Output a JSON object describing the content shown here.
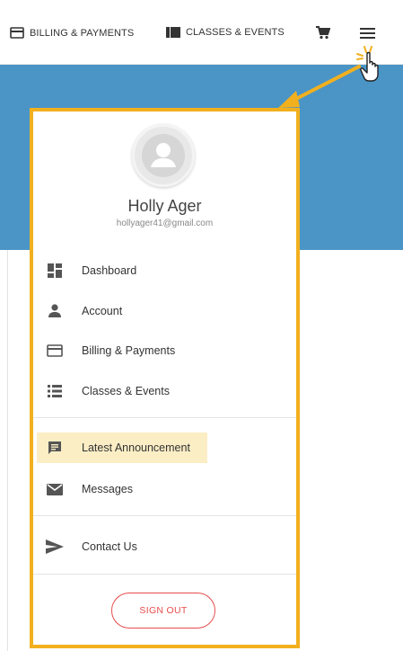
{
  "topbar": {
    "billing_label": "BILLING & PAYMENTS",
    "classes_label": "CLASSES & EVENTS",
    "icons": [
      "card-icon",
      "list-icon",
      "cart-icon",
      "hamburger-menu-icon"
    ]
  },
  "user": {
    "name": "Holly Ager",
    "email": "hollyager41@gmail.com"
  },
  "menu": {
    "items": [
      {
        "label": "Dashboard",
        "icon": "dashboard-icon"
      },
      {
        "label": "Account",
        "icon": "person-icon"
      },
      {
        "label": "Billing & Payments",
        "icon": "card-icon"
      },
      {
        "label": "Classes & Events",
        "icon": "list-icon"
      },
      {
        "label": "Latest Announcement",
        "icon": "announcement-icon",
        "highlighted": true
      },
      {
        "label": "Messages",
        "icon": "envelope-icon"
      },
      {
        "label": "Contact Us",
        "icon": "send-icon"
      }
    ],
    "sign_out_label": "SIGN OUT"
  },
  "colors": {
    "accent_border": "#f2b01e",
    "header_band": "#4a95c6",
    "highlight": "#fbeec5",
    "sign_out": "#e74c4c"
  }
}
